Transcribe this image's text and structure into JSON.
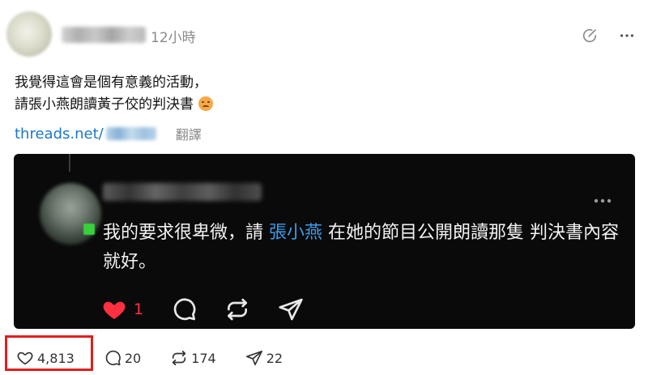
{
  "post": {
    "timestamp": "12小時",
    "text_line1": "我覺得⁣這會是個有意義的活動，",
    "text_line2": "請張小燕朗讀黃子佼的判決書",
    "link_text": "threads.net/",
    "translate_label": "翻譯"
  },
  "embed": {
    "text_before": "我的要求很卑微，請 ",
    "mention": "張小燕",
    "text_after": " 在她的節目公開朗讀那隻 判決書內容就好。",
    "like_count": "1"
  },
  "actions": {
    "likes": "4,813",
    "replies": "20",
    "reposts": "174",
    "shares": "22"
  },
  "colors": {
    "link": "#1d77c5",
    "mention": "#3d9be9",
    "like_red": "#ff3040",
    "highlight_box": "#e01e1e"
  },
  "icons": [
    "edit-circle-icon",
    "more-icon",
    "heart-icon",
    "comment-icon",
    "repost-icon",
    "share-icon"
  ]
}
